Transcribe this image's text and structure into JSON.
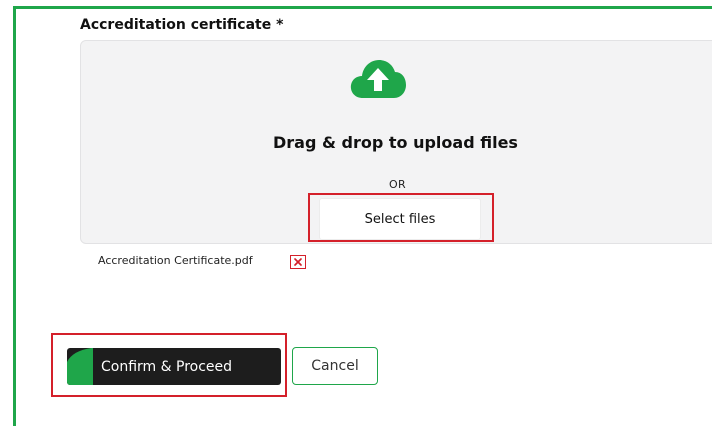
{
  "form": {
    "field_label": "Accreditation certificate *"
  },
  "dropzone": {
    "icon": "cloud-upload-icon",
    "title": "Drag & drop to upload files",
    "or_text": "OR",
    "select_label": "Select files"
  },
  "uploaded_file": {
    "name": "Accreditation Certificate.pdf",
    "remove_icon": "close-icon"
  },
  "actions": {
    "confirm_label": "Confirm & Proceed",
    "cancel_label": "Cancel"
  },
  "colors": {
    "accent_green": "#1fa64a",
    "highlight_red": "#d4202a",
    "dropzone_bg": "#f3f3f4",
    "primary_button": "#1d1d1d"
  }
}
